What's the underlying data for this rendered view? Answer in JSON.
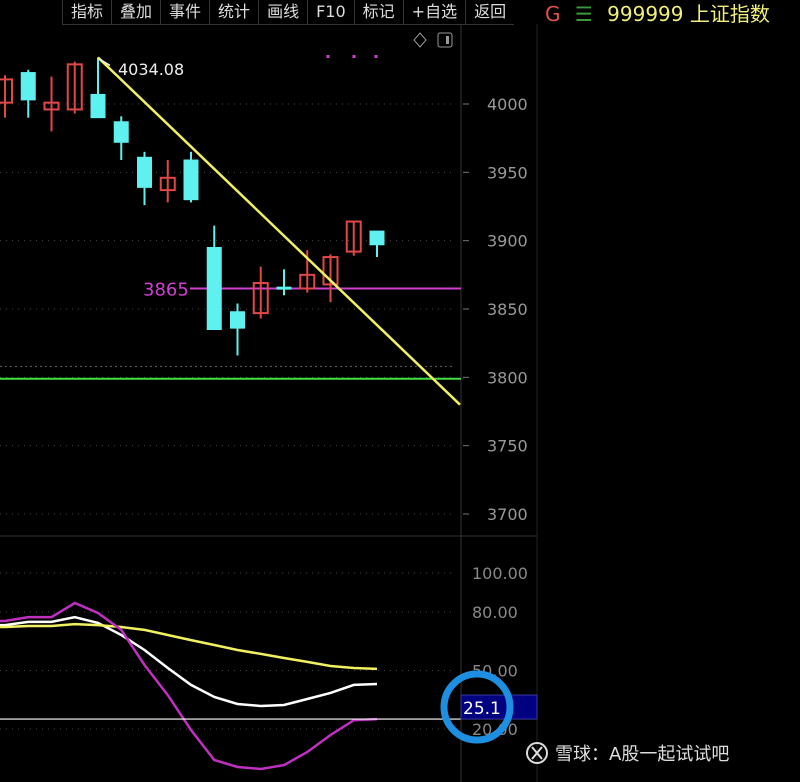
{
  "toolbar": {
    "items": [
      "指标",
      "叠加",
      "事件",
      "统计",
      "画线",
      "F10",
      "标记",
      "+自选",
      "返回"
    ]
  },
  "header": {
    "g_label": "G",
    "menu_icon": "menu-icon",
    "code": "999999",
    "name": "上证指数"
  },
  "watermark": {
    "text": "雪球：A股一起试试吧",
    "icon": "xueqiu-logo"
  },
  "colors": {
    "up": "#e04848",
    "down": "#5ff0f0",
    "trend": "#f0f060",
    "support": "#d040d0",
    "green_line": "#40e040",
    "k": "#ffffff",
    "d": "#f0f060",
    "j": "#c030c0",
    "highlight": "#1e8fe0",
    "label_bg": "#000080"
  },
  "chart_data": [
    {
      "type": "candlestick",
      "ylim": [
        3670,
        4055
      ],
      "y_ticks": [
        4000,
        3950,
        3900,
        3850,
        3800,
        3750,
        3700
      ],
      "grid": true,
      "candles": [
        {
          "o": 4001,
          "h": 4021,
          "l": 3990,
          "c": 4018
        },
        {
          "o": 4023,
          "h": 4025,
          "l": 3990,
          "c": 4003
        },
        {
          "o": 3996,
          "h": 4020,
          "l": 3980,
          "c": 4001
        },
        {
          "o": 3996,
          "h": 4031,
          "l": 3993,
          "c": 4029
        },
        {
          "o": 4007,
          "h": 4034.08,
          "l": 3990,
          "c": 3990
        },
        {
          "o": 3987,
          "h": 3991,
          "l": 3959,
          "c": 3972
        },
        {
          "o": 3961,
          "h": 3965,
          "l": 3926,
          "c": 3939
        },
        {
          "o": 3937,
          "h": 3959,
          "l": 3928,
          "c": 3946
        },
        {
          "o": 3959,
          "h": 3965,
          "l": 3928,
          "c": 3930
        },
        {
          "o": 3895,
          "h": 3911,
          "l": 3835,
          "c": 3835
        },
        {
          "o": 3848,
          "h": 3854,
          "l": 3816,
          "c": 3836
        },
        {
          "o": 3847,
          "h": 3881,
          "l": 3843,
          "c": 3869
        },
        {
          "o": 3866,
          "h": 3879,
          "l": 3860,
          "c": 3865
        },
        {
          "o": 3865,
          "h": 3893,
          "l": 3862,
          "c": 3875
        },
        {
          "o": 3868,
          "h": 3890,
          "l": 3855,
          "c": 3888
        },
        {
          "o": 3892,
          "h": 3914,
          "l": 3889,
          "c": 3914
        },
        {
          "o": 3907,
          "h": 3907,
          "l": 3888,
          "c": 3897
        }
      ],
      "annotations": {
        "high_label": "4034.08",
        "support_level": 3865,
        "support_label": "3865",
        "green_level": 3799,
        "dotted_level": 3808,
        "trendline": {
          "from": {
            "index": 4,
            "price": 4034.08
          },
          "to_price_at_right_edge": 3780
        }
      }
    },
    {
      "type": "line",
      "ylim": [
        -5,
        110
      ],
      "y_ticks": [
        "100.00",
        "80.00",
        "50.00",
        "20.00"
      ],
      "y_tick_values": [
        100,
        80,
        50,
        20
      ],
      "reference_value": 25.1,
      "reference_label": "25.1",
      "series": [
        {
          "values": [
            73.3,
            74.9,
            74.9,
            77.4,
            74.4,
            68.2,
            60.5,
            51.3,
            42.6,
            36.4,
            32.8,
            31.8,
            32.3,
            35.4,
            38.5,
            42.6,
            43.1
          ],
          "color": "#ffffff"
        },
        {
          "values": [
            72.3,
            72.8,
            72.8,
            73.8,
            73.3,
            72.3,
            70.8,
            68.2,
            65.6,
            63.1,
            60.5,
            58.5,
            56.4,
            54.4,
            52.3,
            51.3,
            50.8
          ],
          "color": "#f0f060"
        },
        {
          "values": [
            75.4,
            77.4,
            77.4,
            84.6,
            79.5,
            70.8,
            52.8,
            37.4,
            19.5,
            4.1,
            0.5,
            -0.5,
            1.5,
            8.2,
            16.9,
            24.5,
            25.1
          ],
          "color": "#c030c0"
        }
      ]
    }
  ]
}
